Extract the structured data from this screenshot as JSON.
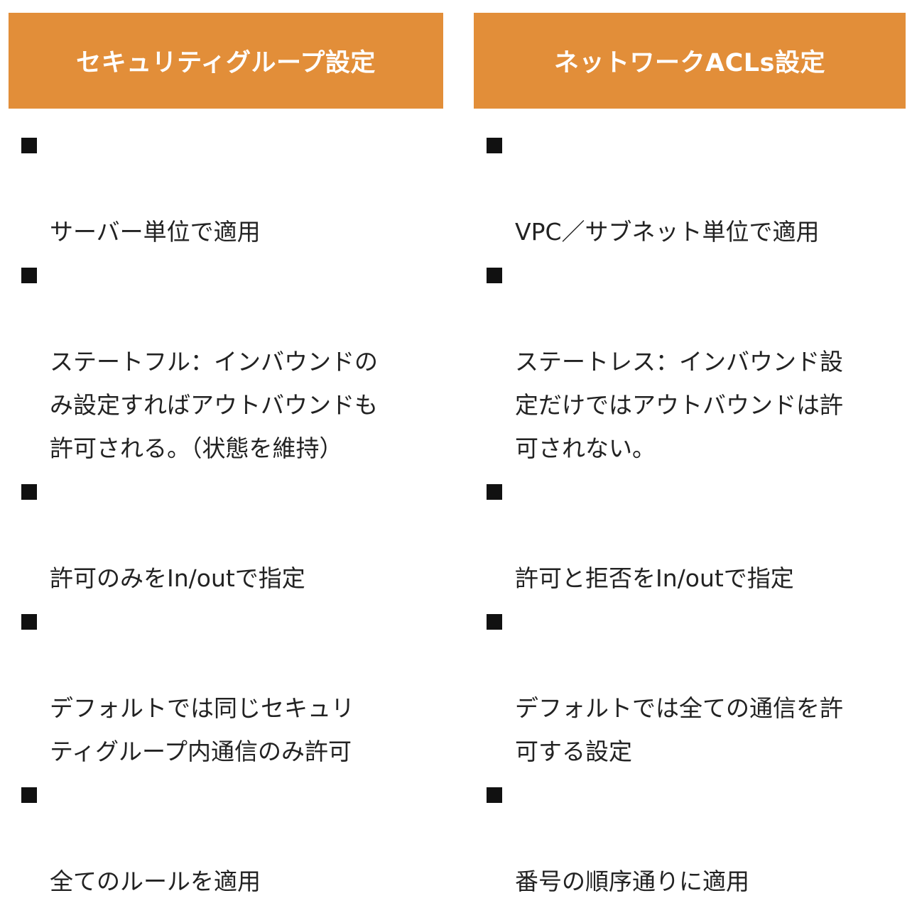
{
  "left": {
    "header": "セキュリティグループ設定",
    "items": [
      "サーバー単位で適用",
      "ステートフル：インバウンドの\nみ設定すればアウトバウンドも\n許可される。（状態を維持）",
      "許可のみをIn/outで指定",
      "デフォルトでは同じセキュリ\nティグループ内通信のみ許可",
      "全てのルールを適用"
    ]
  },
  "right": {
    "header": "ネットワークACLs設定",
    "items": [
      "VPC／サブネット単位で適用",
      "ステートレス：インバウンド設\n定だけではアウトバウンドは許\n可されない。",
      "許可と拒否をIn/outで指定",
      "デフォルトでは全ての通信を許\n可する設定",
      "番号の順序通りに適用"
    ]
  },
  "colors": {
    "header_bg": "#e28e39",
    "header_text": "#ffffff",
    "body_text": "#222222",
    "bullet": "#111111"
  }
}
